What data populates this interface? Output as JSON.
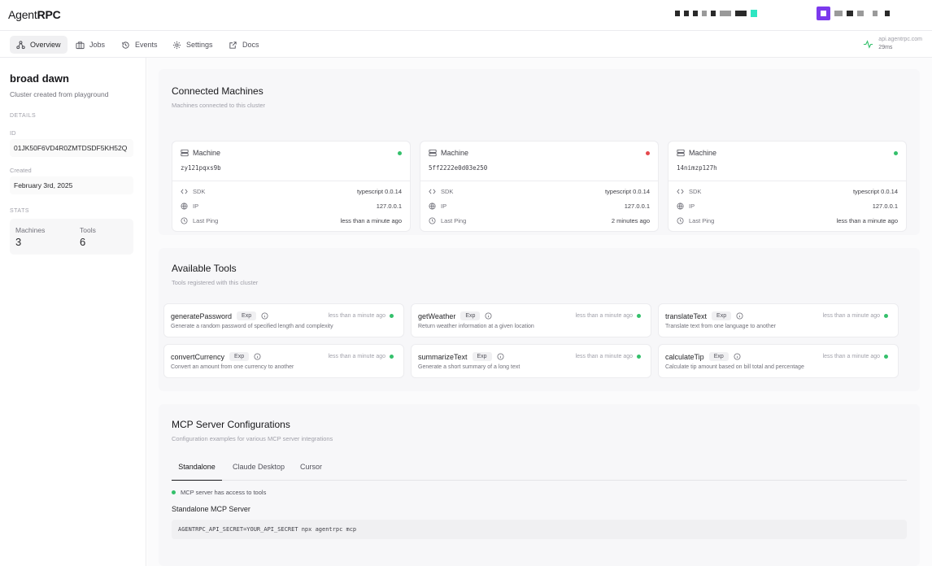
{
  "app": {
    "logo_part1": "Agent",
    "logo_part2": "RPC"
  },
  "nav": {
    "items": [
      {
        "label": "Overview",
        "icon": "overview-icon"
      },
      {
        "label": "Jobs",
        "icon": "briefcase-icon"
      },
      {
        "label": "Events",
        "icon": "history-icon"
      },
      {
        "label": "Settings",
        "icon": "gear-icon"
      },
      {
        "label": "Docs",
        "icon": "external-link-icon"
      }
    ],
    "latency_host": "api.agentrpc.com",
    "latency_ms": "29ms"
  },
  "sidebar": {
    "cluster_name": "broad dawn",
    "cluster_desc": "Cluster created from playground",
    "details_label": "DETAILS",
    "id_label": "ID",
    "id_value": "01JK50F6VD4R0ZMTDSDF5KH52Q",
    "created_label": "Created",
    "created_value": "February 3rd, 2025",
    "stats_label": "STATS",
    "machines_label": "Machines",
    "machines_value": "3",
    "tools_label": "Tools",
    "tools_value": "6"
  },
  "machines_section": {
    "title": "Connected Machines",
    "subtitle": "Machines connected to this cluster",
    "machines": [
      {
        "label": "Machine",
        "id": "zy121pqxs9b",
        "status_color": "#34c06b",
        "sdk_label": "SDK",
        "sdk": "typescript 0.0.14",
        "ip_label": "IP",
        "ip": "127.0.0.1",
        "ping_label": "Last Ping",
        "ping": "less than a minute ago"
      },
      {
        "label": "Machine",
        "id": "5ff2222e0d03e250",
        "status_color": "#e5484d",
        "sdk_label": "SDK",
        "sdk": "typescript 0.0.14",
        "ip_label": "IP",
        "ip": "127.0.0.1",
        "ping_label": "Last Ping",
        "ping": "2 minutes ago"
      },
      {
        "label": "Machine",
        "id": "14nimzp127h",
        "status_color": "#34c06b",
        "sdk_label": "SDK",
        "sdk": "typescript 0.0.14",
        "ip_label": "IP",
        "ip": "127.0.0.1",
        "ping_label": "Last Ping",
        "ping": "less than a minute ago"
      }
    ]
  },
  "tools_section": {
    "title": "Available Tools",
    "subtitle": "Tools registered with this cluster",
    "badge": "Exp",
    "tools": [
      {
        "name": "generatePassword",
        "time": "less than a minute ago",
        "desc": "Generate a random password of specified length and complexity"
      },
      {
        "name": "getWeather",
        "time": "less than a minute ago",
        "desc": "Return weather information at a given location"
      },
      {
        "name": "translateText",
        "time": "less than a minute ago",
        "desc": "Translate text from one language to another"
      },
      {
        "name": "convertCurrency",
        "time": "less than a minute ago",
        "desc": "Convert an amount from one currency to another"
      },
      {
        "name": "summarizeText",
        "time": "less than a minute ago",
        "desc": "Generate a short summary of a long text"
      },
      {
        "name": "calculateTip",
        "time": "less than a minute ago",
        "desc": "Calculate tip amount based on bill total and percentage"
      }
    ]
  },
  "mcp_section": {
    "title": "MCP Server Configurations",
    "subtitle": "Configuration examples for various MCP server integrations",
    "tabs": [
      "Standalone",
      "Claude Desktop",
      "Cursor"
    ],
    "status": "MCP server has access to tools",
    "heading": "Standalone MCP Server",
    "code": "AGENTRPC_API_SECRET=YOUR_API_SECRET npx agentrpc mcp"
  }
}
